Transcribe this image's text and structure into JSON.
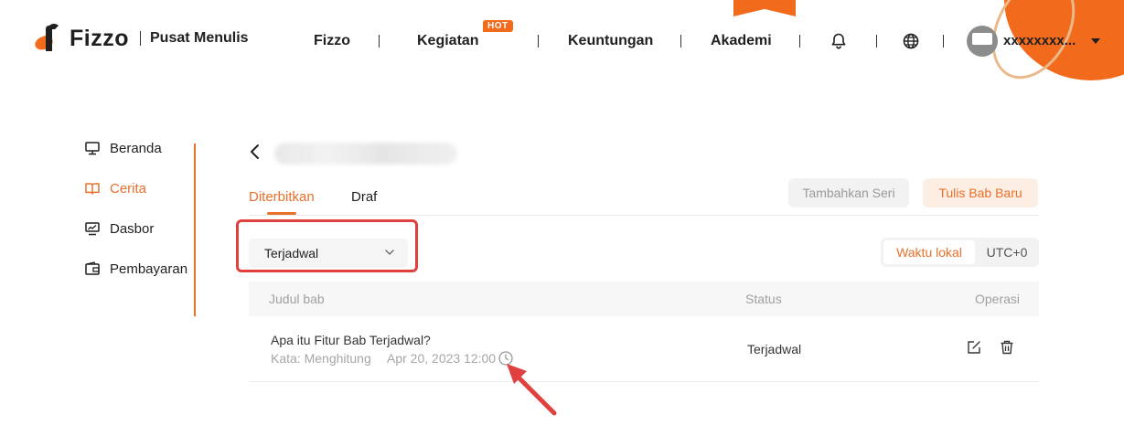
{
  "header": {
    "brand": "Fizzo",
    "subtitle": "Pusat Menulis",
    "nav": [
      {
        "label": "Fizzo"
      },
      {
        "label": "Kegiatan",
        "badge": "HOT"
      },
      {
        "label": "Keuntungan"
      },
      {
        "label": "Akademi"
      }
    ],
    "icons": [
      "bell-icon",
      "globe-icon"
    ],
    "username": "xxxxxxxx..."
  },
  "sidebar": {
    "items": [
      {
        "label": "Beranda",
        "icon": "monitor-icon",
        "active": false
      },
      {
        "label": "Cerita",
        "icon": "book-icon",
        "active": true
      },
      {
        "label": "Dasbor",
        "icon": "dashboard-icon",
        "active": false
      },
      {
        "label": "Pembayaran",
        "icon": "wallet-icon",
        "active": false
      }
    ]
  },
  "main": {
    "tabs": [
      {
        "label": "Diterbitkan",
        "active": true
      },
      {
        "label": "Draf",
        "active": false
      }
    ],
    "buttons": {
      "add_series": "Tambahkan Seri",
      "new_chapter": "Tulis Bab Baru"
    },
    "filter": {
      "selected": "Terjadwal"
    },
    "timezone": {
      "options": [
        "Waktu lokal",
        "UTC+0"
      ],
      "selected": "Waktu lokal"
    },
    "table": {
      "columns": [
        "Judul bab",
        "Status",
        "Operasi"
      ],
      "rows": [
        {
          "title": "Apa itu Fitur Bab Terjadwal?",
          "words": "Kata: Menghitung",
          "scheduled": "Apr 20, 2023 12:00",
          "status": "Terjadwal"
        }
      ]
    }
  },
  "colors": {
    "accent": "#e8702b",
    "brand_orange": "#f26a1b",
    "annotation_red": "#e0413f"
  }
}
